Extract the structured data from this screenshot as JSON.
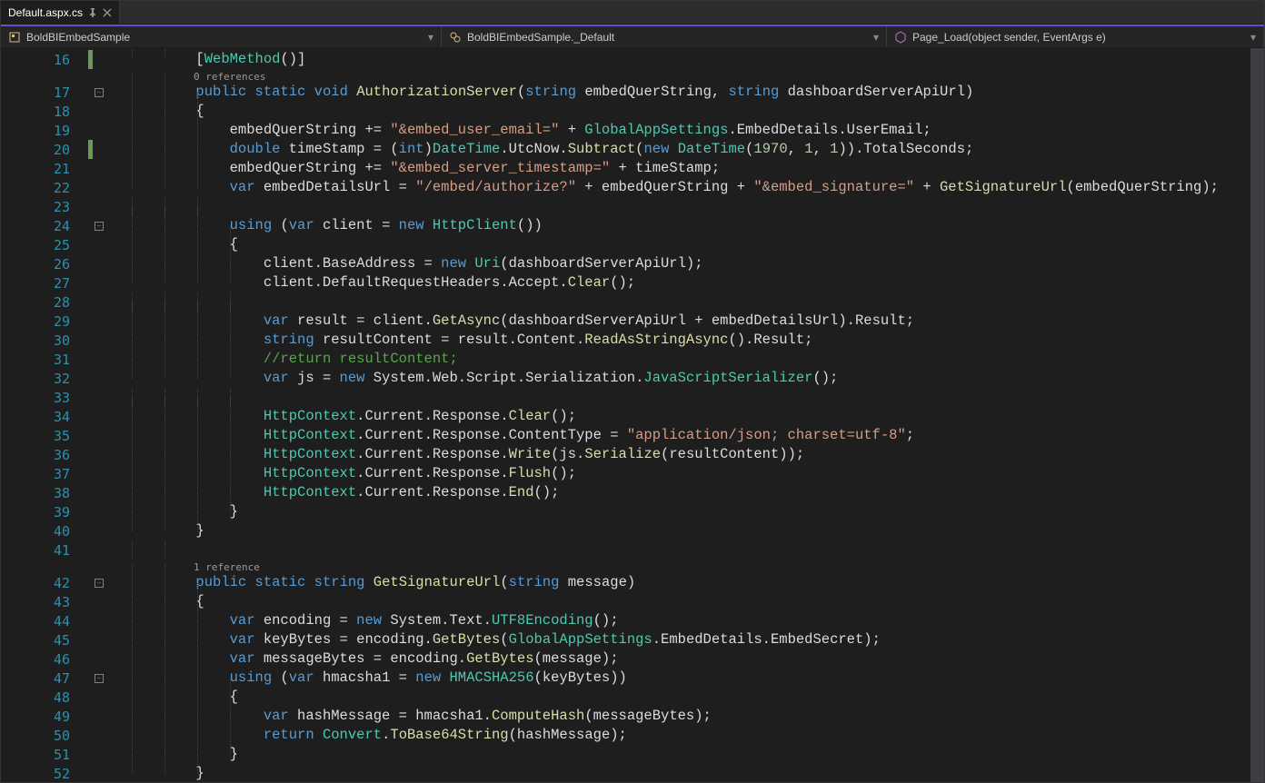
{
  "tab": {
    "filename": "Default.aspx.cs"
  },
  "nav": {
    "namespace": "BoldBIEmbedSample",
    "class": "BoldBIEmbedSample._Default",
    "method": "Page_Load(object sender, EventArgs e)"
  },
  "codelens": {
    "refs0": "0 references",
    "refs1": "1 reference"
  },
  "lines": {
    "start": 16,
    "end": 52
  },
  "code": {
    "l16": "[WebMethod()]",
    "l17_sig": "public static void AuthorizationServer(string embedQuerString, string dashboardServerApiUrl)",
    "l19_str1": "\"&embed_user_email=\"",
    "l21_str1": "\"&embed_server_timestamp=\"",
    "l22_str1": "\"/embed/authorize?\"",
    "l22_str2": "\"&embed_signature=\"",
    "l31_comment": "//return resultContent;",
    "l35_str": "\"application/json; charset=utf-8\"",
    "numbers": {
      "y": "1970",
      "m": "1",
      "d": "1"
    }
  }
}
